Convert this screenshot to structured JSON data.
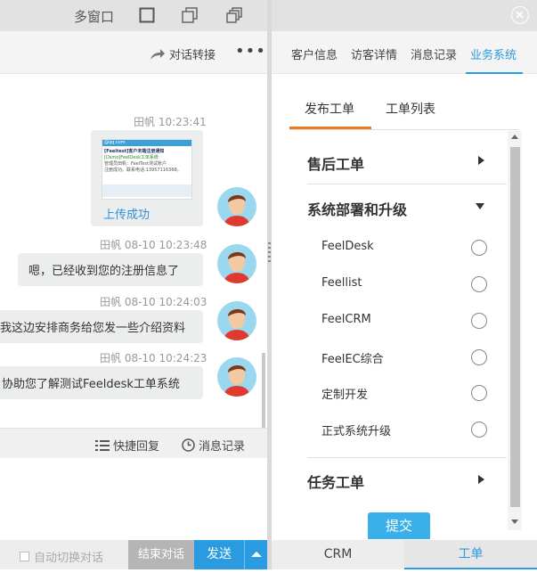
{
  "window": {
    "multi_label": "多窗口"
  },
  "chat_toolbar": {
    "transfer_label": "对话转接",
    "more_label": "•••"
  },
  "messages": [
    {
      "time": "田帆 10:23:41",
      "image_title": "[Feeltest]客户未端注册通知",
      "image_line1": "[Dsmo]FeelDesk工单系统",
      "image_line2": "管理员田帆：FeelTest测试账户",
      "image_line3": "注册成功。联系电话:13957116368。",
      "image_email": "@qq.com",
      "upload_text": "上传成功"
    },
    {
      "time": "田帆 08-10 10:23:48",
      "text": "嗯，已经收到您的注册信息了"
    },
    {
      "time": "田帆 08-10 10:24:03",
      "text": "我这边安排商务给您发一些介绍资料"
    },
    {
      "time": "田帆 08-10 10:24:23",
      "text": "协助您了解测试Feeldesk工单系统"
    }
  ],
  "quick": {
    "reply_label": "快捷回复",
    "history_label": "消息记录"
  },
  "bottom": {
    "auto_switch": "自动切换对话",
    "end_label": "结束对话",
    "send_label": "发送"
  },
  "right_tabs": [
    {
      "label": "客户信息",
      "active": false
    },
    {
      "label": "访客详情",
      "active": false
    },
    {
      "label": "消息记录",
      "active": false
    },
    {
      "label": "业务系统",
      "active": true
    }
  ],
  "sub_tabs": [
    {
      "label": "发布工单",
      "active": true
    },
    {
      "label": "工单列表",
      "active": false
    }
  ],
  "sections": {
    "after_sales": "售后工单",
    "deploy": "系统部署和升级",
    "task": "任务工单"
  },
  "options": [
    "FeelDesk",
    "Feellist",
    "FeelCRM",
    "FeelEC综合",
    "定制开发",
    "正式系统升级"
  ],
  "submit_label": "提交",
  "bottom_tabs": [
    {
      "label": "CRM",
      "active": false
    },
    {
      "label": "工单",
      "active": true
    }
  ],
  "colors": {
    "accent": "#2a9be0",
    "orange": "#f07a1c",
    "grey_btn": "#b5b5b5"
  }
}
